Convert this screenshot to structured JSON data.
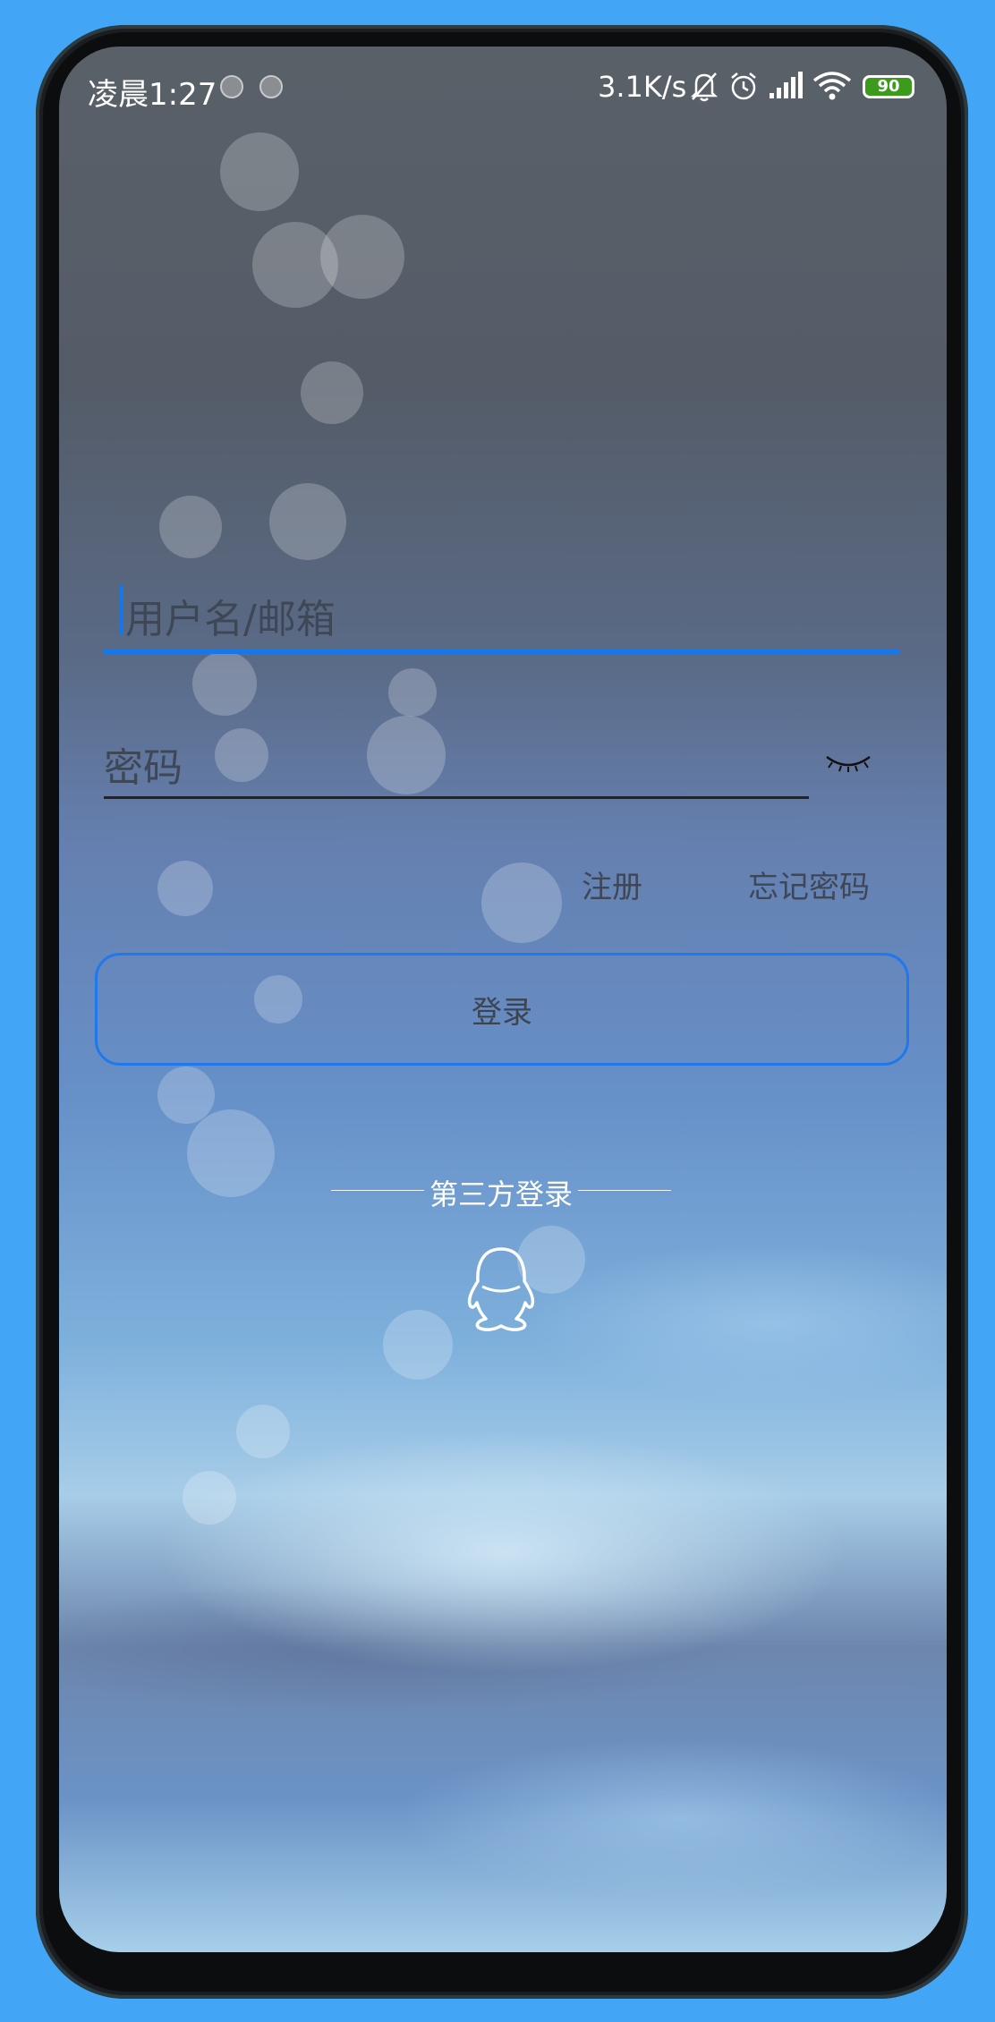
{
  "status_bar": {
    "time": "凌晨1:27",
    "network_speed": "3.1K/s",
    "battery_level": "90",
    "icons": [
      "notification-dot-icon",
      "notification-dot-icon",
      "mute-bell-icon",
      "alarm-icon",
      "cellular-signal-icon",
      "wifi-icon",
      "battery-icon"
    ]
  },
  "login_form": {
    "username_placeholder": "用户名/邮箱",
    "password_placeholder": "密码",
    "password_toggle_icon": "eye-closed-icon",
    "register_link": "注册",
    "forgot_password_link": "忘记密码",
    "login_button": "登录"
  },
  "third_party": {
    "heading": "第三方登录",
    "providers": [
      {
        "icon": "qq-penguin-icon"
      }
    ]
  },
  "colors": {
    "accent": "#1877e8",
    "page_background": "#42a5f5",
    "battery_fill": "#3c9a1c"
  }
}
